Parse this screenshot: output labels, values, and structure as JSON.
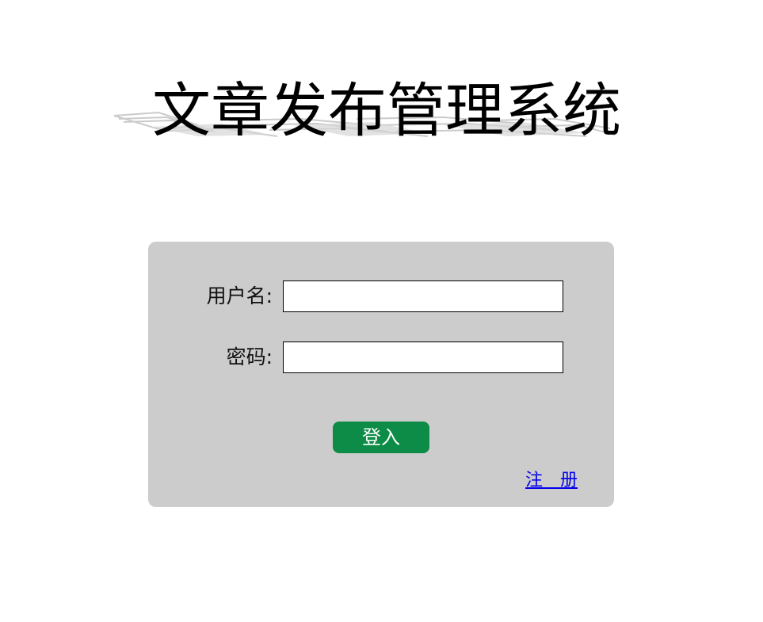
{
  "app": {
    "title": "文章发布管理系统"
  },
  "login_form": {
    "username_label": "用户名:",
    "username_value": "",
    "password_label": "密码:",
    "password_value": "",
    "login_button_label": "登入",
    "register_link_label": "注　册"
  },
  "colors": {
    "panel_background": "#cccccc",
    "login_button": "#0c8c46",
    "register_link": "#0000ee",
    "title_shadow": "#c8c8c8"
  },
  "icons": {
    "title_decoration": "reflection-shadow"
  }
}
